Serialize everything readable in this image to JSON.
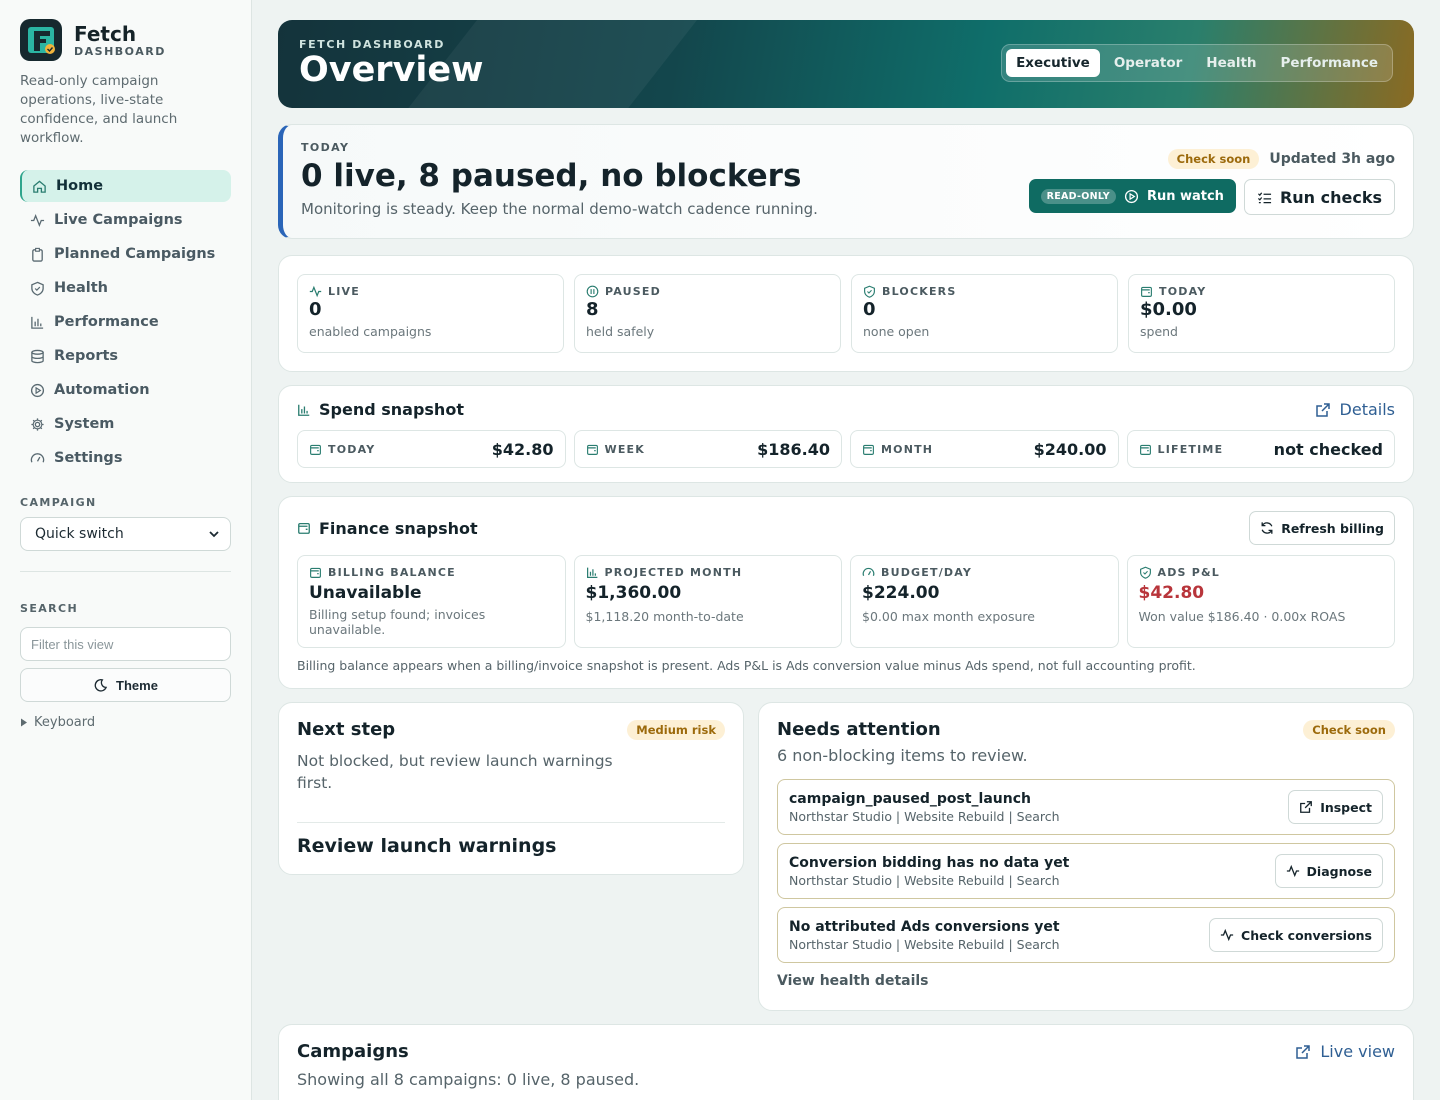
{
  "sidebar": {
    "brand_name": "Fetch",
    "brand_sub": "DASHBOARD",
    "tagline": "Read-only campaign operations, live-state confidence, and launch workflow.",
    "nav": [
      {
        "label": "Home",
        "icon": "home-icon"
      },
      {
        "label": "Live Campaigns",
        "icon": "activity-icon"
      },
      {
        "label": "Planned Campaigns",
        "icon": "clipboard-icon"
      },
      {
        "label": "Health",
        "icon": "shield-icon"
      },
      {
        "label": "Performance",
        "icon": "bar-chart-icon"
      },
      {
        "label": "Reports",
        "icon": "database-icon"
      },
      {
        "label": "Automation",
        "icon": "play-circle-icon"
      },
      {
        "label": "System",
        "icon": "gear-icon"
      },
      {
        "label": "Settings",
        "icon": "gauge-icon"
      }
    ],
    "campaign_label": "CAMPAIGN",
    "campaign_select": "Quick switch",
    "search_label": "SEARCH",
    "search_placeholder": "Filter this view",
    "theme_label": "Theme",
    "keyboard_label": "Keyboard"
  },
  "hero": {
    "kicker": "FETCH DASHBOARD",
    "title": "Overview",
    "tabs": [
      "Executive",
      "Operator",
      "Health",
      "Performance"
    ],
    "active_tab": "Executive"
  },
  "today": {
    "kicker": "TODAY",
    "title": "0 live, 8 paused, no blockers",
    "subtitle": "Monitoring is steady. Keep the normal demo-watch cadence running.",
    "status_pill": "Check soon",
    "updated": "Updated 3h ago",
    "readonly_badge": "READ-ONLY",
    "run_watch": "Run watch",
    "run_checks": "Run checks"
  },
  "stats": [
    {
      "label": "LIVE",
      "value": "0",
      "sub": "enabled campaigns",
      "icon": "activity-icon"
    },
    {
      "label": "PAUSED",
      "value": "8",
      "sub": "held safely",
      "icon": "pause-icon"
    },
    {
      "label": "BLOCKERS",
      "value": "0",
      "sub": "none open",
      "icon": "shield-icon"
    },
    {
      "label": "TODAY",
      "value": "$0.00",
      "sub": "spend",
      "icon": "wallet-icon"
    }
  ],
  "spend": {
    "title": "Spend snapshot",
    "details_link": "Details",
    "cells": [
      {
        "label": "TODAY",
        "value": "$42.80"
      },
      {
        "label": "WEEK",
        "value": "$186.40"
      },
      {
        "label": "MONTH",
        "value": "$240.00"
      },
      {
        "label": "LIFETIME",
        "value": "not checked"
      }
    ]
  },
  "finance": {
    "title": "Finance snapshot",
    "refresh": "Refresh billing",
    "cells": [
      {
        "label": "BILLING BALANCE",
        "value": "Unavailable",
        "sub": "Billing setup found; invoices unavailable.",
        "icon": "wallet-icon"
      },
      {
        "label": "PROJECTED MONTH",
        "value": "$1,360.00",
        "sub": "$1,118.20 month-to-date",
        "icon": "bar-chart-icon"
      },
      {
        "label": "BUDGET/DAY",
        "value": "$224.00",
        "sub": "$0.00 max month exposure",
        "icon": "gauge-icon"
      },
      {
        "label": "ADS P&L",
        "value": "$42.80",
        "sub": "Won value $186.40 · 0.00x ROAS",
        "icon": "shield-icon"
      }
    ],
    "note": "Billing balance appears when a billing/invoice snapshot is present. Ads P&L is Ads conversion value minus Ads spend, not full accounting profit."
  },
  "next_step": {
    "title": "Next step",
    "risk": "Medium risk",
    "subtitle": "Not blocked, but review launch warnings first.",
    "action": "Review launch warnings"
  },
  "attention": {
    "title": "Needs attention",
    "pill": "Check soon",
    "subtitle": "6 non-blocking items to review.",
    "items": [
      {
        "title": "campaign_paused_post_launch",
        "meta": "Northstar Studio | Website Rebuild | Search",
        "action": "Inspect"
      },
      {
        "title": "Conversion bidding has no data yet",
        "meta": "Northstar Studio | Website Rebuild | Search",
        "action": "Diagnose"
      },
      {
        "title": "No attributed Ads conversions yet",
        "meta": "Northstar Studio | Website Rebuild | Search",
        "action": "Check conversions"
      }
    ],
    "view_link": "View health details"
  },
  "campaigns": {
    "title": "Campaigns",
    "subtitle": "Showing all 8 campaigns: 0 live, 8 paused.",
    "link": "Live view"
  },
  "colors": {
    "accent": "#0f6b62",
    "warn_bg": "#fdf0d5",
    "warn_text": "#9c6a0c",
    "negative": "#b8353b"
  }
}
